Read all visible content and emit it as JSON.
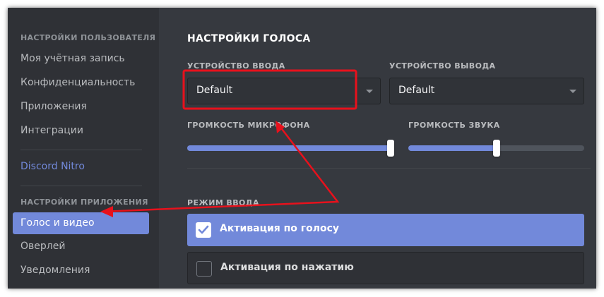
{
  "sidebar": {
    "user_settings_header": "НАСТРОЙКИ ПОЛЬЗОВАТЕЛЯ",
    "user_items": [
      {
        "label": "Моя учётная запись"
      },
      {
        "label": "Конфиденциальность"
      },
      {
        "label": "Приложения"
      },
      {
        "label": "Интеграции"
      }
    ],
    "nitro_label": "Discord Nitro",
    "app_settings_header": "НАСТРОЙКИ ПРИЛОЖЕНИЯ",
    "app_items": [
      {
        "label": "Голос и видео",
        "active": true
      },
      {
        "label": "Оверлей"
      },
      {
        "label": "Уведомления"
      }
    ]
  },
  "voice": {
    "title": "НАСТРОЙКИ ГОЛОСА",
    "input_device_label": "УСТРОЙСТВО ВВОДА",
    "input_device_value": "Default",
    "output_device_label": "УСТРОЙСТВО ВЫВОДА",
    "output_device_value": "Default",
    "mic_volume_label": "ГРОМКОСТЬ МИКРОФОНА",
    "mic_volume": 1.0,
    "sound_volume_label": "ГРОМКОСТЬ ЗВУКА",
    "sound_volume": 0.5,
    "input_mode_label": "РЕЖИМ ВВОДА",
    "modes": [
      {
        "label": "Активация по голосу",
        "selected": true
      },
      {
        "label": "Активация по нажатию",
        "selected": false
      }
    ]
  },
  "colors": {
    "accent": "#7289da",
    "annotation": "#e8111c"
  }
}
